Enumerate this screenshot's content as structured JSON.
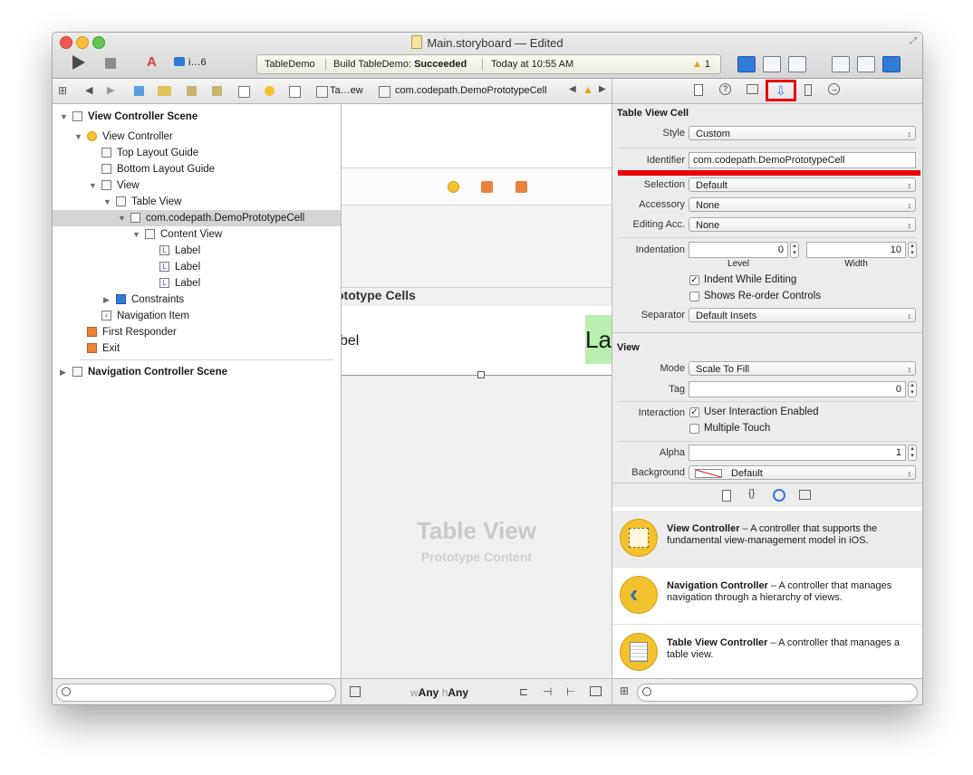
{
  "window": {
    "title": "Main.storyboard — Edited"
  },
  "toolbar": {
    "scheme": "i…6",
    "activity": {
      "project": "TableDemo",
      "build_prefix": "Build TableDemo:",
      "build_status": "Succeeded",
      "time": "Today at 10:55 AM",
      "warning_count": "1"
    }
  },
  "jumpbar": {
    "crumb_table": "Ta…ew",
    "crumb_cell": "com.codepath.DemoPrototypeCell"
  },
  "outline": {
    "items": [
      {
        "label": "View Controller Scene"
      },
      {
        "label": "View Controller"
      },
      {
        "label": "Top Layout Guide"
      },
      {
        "label": "Bottom Layout Guide"
      },
      {
        "label": "View"
      },
      {
        "label": "Table View"
      },
      {
        "label": "com.codepath.DemoPrototypeCell"
      },
      {
        "label": "Content View"
      },
      {
        "label": "Label"
      },
      {
        "label": "Label"
      },
      {
        "label": "Label"
      },
      {
        "label": "Constraints"
      },
      {
        "label": "Navigation Item"
      },
      {
        "label": "First Responder"
      },
      {
        "label": "Exit"
      },
      {
        "label": "Navigation Controller Scene"
      }
    ]
  },
  "canvas": {
    "header": "ototype Cells",
    "cell_left": "bel",
    "cell_right": "La",
    "placeholder_title": "Table View",
    "placeholder_sub": "Prototype Content",
    "size_w": "w",
    "size_w_val": "Any",
    "size_h": "h",
    "size_h_val": "Any"
  },
  "inspector": {
    "cell_section": "Table View Cell",
    "style_label": "Style",
    "style_value": "Custom",
    "identifier_label": "Identifier",
    "identifier_value": "com.codepath.DemoPrototypeCell",
    "selection_label": "Selection",
    "selection_value": "Default",
    "accessory_label": "Accessory",
    "accessory_value": "None",
    "editing_acc_label": "Editing Acc.",
    "editing_acc_value": "None",
    "indentation_label": "Indentation",
    "level_value": "0",
    "level_caption": "Level",
    "width_value": "10",
    "width_caption": "Width",
    "indent_while_editing": "Indent While Editing",
    "shows_reorder": "Shows Re-order Controls",
    "separator_label": "Separator",
    "separator_value": "Default Insets",
    "view_section": "View",
    "mode_label": "Mode",
    "mode_value": "Scale To Fill",
    "tag_label": "Tag",
    "tag_value": "0",
    "interaction_label": "Interaction",
    "user_interaction": "User Interaction Enabled",
    "multiple_touch": "Multiple Touch",
    "alpha_label": "Alpha",
    "alpha_value": "1",
    "background_label": "Background",
    "background_value": "Default"
  },
  "library": {
    "items": [
      {
        "title": "View Controller",
        "desc": " – A controller that supports the fundamental view-management model in iOS."
      },
      {
        "title": "Navigation Controller",
        "desc": " – A controller that manages navigation through a hierarchy of views."
      },
      {
        "title": "Table View Controller",
        "desc": " – A controller that manages a table view."
      }
    ]
  },
  "colors": {
    "highlight_red": "#e8000b",
    "accent_blue": "#2f7bd6",
    "vc_yellow": "#f2c12e"
  }
}
